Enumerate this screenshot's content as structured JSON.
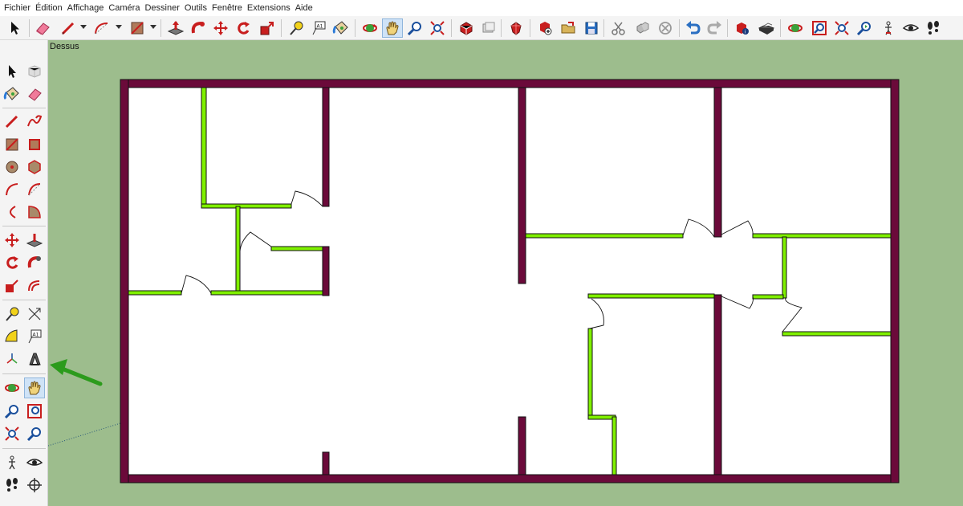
{
  "menu": {
    "items": [
      "Fichier",
      "Édition",
      "Affichage",
      "Caméra",
      "Dessiner",
      "Outils",
      "Fenêtre",
      "Extensions",
      "Aide"
    ]
  },
  "toolbar": {
    "icons": [
      "select-icon",
      "eraser-icon",
      "line-icon",
      "arc-icon",
      "rectangle-icon",
      "push-pull-icon",
      "move-icon",
      "rotate-icon",
      "scale-icon",
      "tape-measure-icon",
      "text-icon",
      "paint-bucket-icon",
      "orbit-icon",
      "pan-icon",
      "zoom-icon",
      "zoom-extents-icon",
      "3d-warehouse-icon",
      "extension-warehouse-icon",
      "ruby-icon",
      "new-icon",
      "open-icon",
      "save-icon",
      "cut-icon",
      "copy-icon",
      "delete-icon",
      "undo-icon",
      "redo-icon",
      "model-info-icon",
      "print-icon",
      "previous-view-icon",
      "zoom-window-icon",
      "zoom-extents-icon",
      "position-camera-icon",
      "look-around-icon",
      "walk-icon"
    ],
    "active": "pan-icon"
  },
  "left_toolbar": {
    "active": "pan-icon",
    "annotation": "green-arrow-pointing-at-3d-text-tool"
  },
  "viewport": {
    "scene_label": "Dessus",
    "background_color": "#9dbd8d",
    "exterior_wall_color": "#6b0a3a",
    "interior_wall_color": "#7ff000",
    "floor_color": "#ffffff"
  }
}
